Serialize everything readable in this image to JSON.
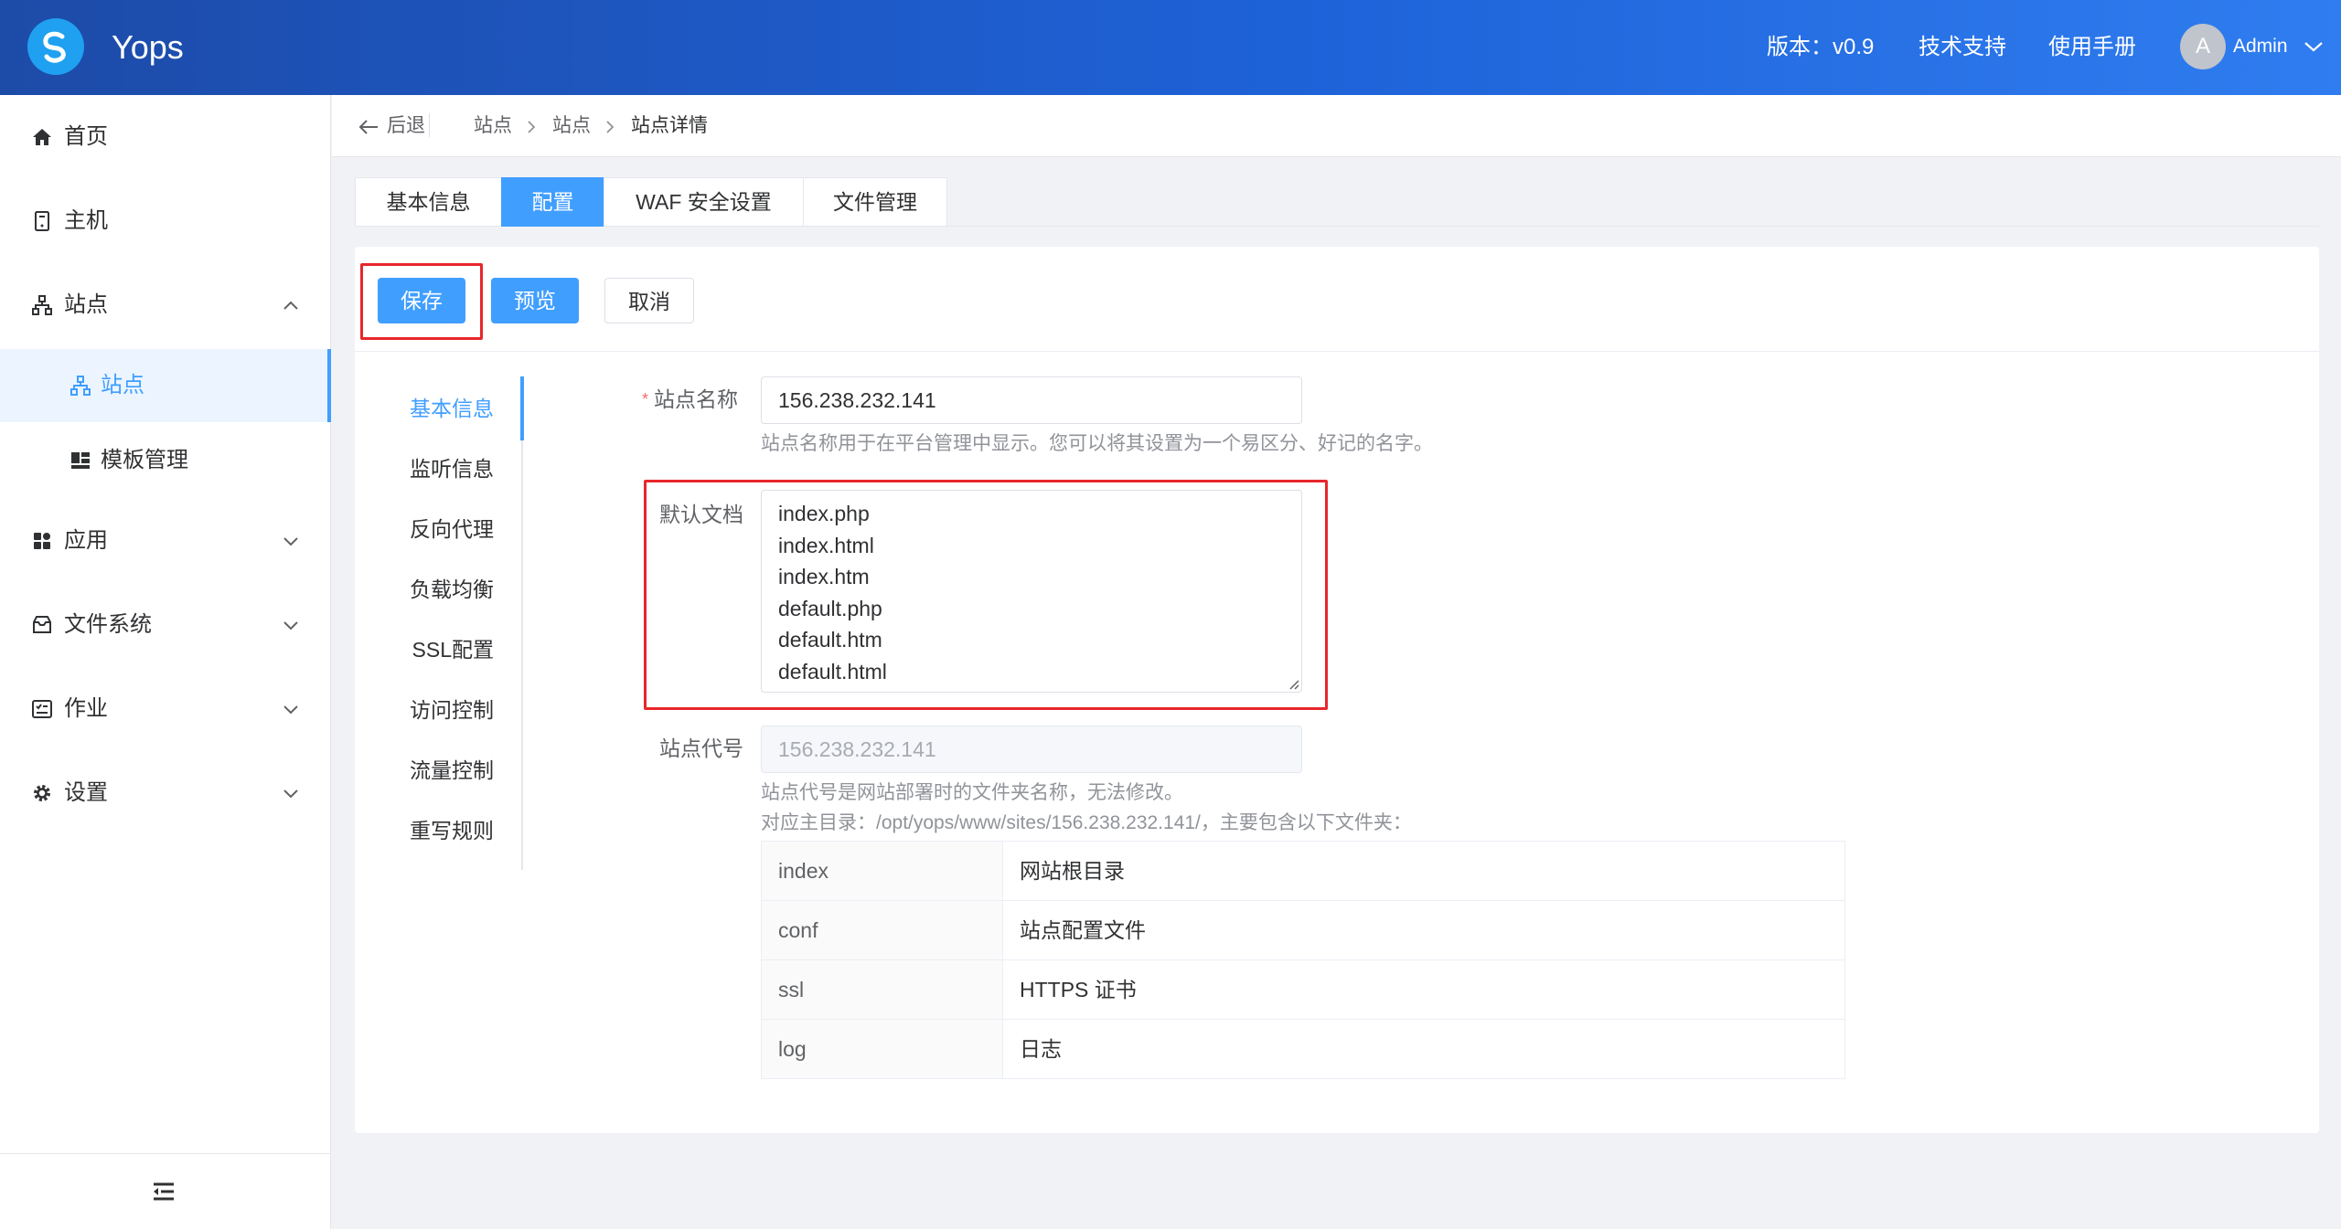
{
  "header": {
    "app_name": "Yops",
    "version": "版本：v0.9",
    "support": "技术支持",
    "manual": "使用手册",
    "avatar_letter": "A",
    "user": "Admin"
  },
  "sidebar": {
    "items": [
      {
        "label": "首页",
        "icon": "home-icon"
      },
      {
        "label": "主机",
        "icon": "server-icon"
      },
      {
        "label": "站点",
        "icon": "sitemap-icon"
      },
      {
        "label": "站点",
        "icon": "sitemap-icon"
      },
      {
        "label": "模板管理",
        "icon": "template-icon"
      },
      {
        "label": "应用",
        "icon": "apps-icon"
      },
      {
        "label": "文件系统",
        "icon": "storage-icon"
      },
      {
        "label": "作业",
        "icon": "job-icon"
      },
      {
        "label": "设置",
        "icon": "gear-icon"
      }
    ]
  },
  "breadcrumb": {
    "back": "后退",
    "items": [
      "站点",
      "站点",
      "站点详情"
    ]
  },
  "tabs": [
    {
      "label": "基本信息"
    },
    {
      "label": "配置"
    },
    {
      "label": "WAF 安全设置"
    },
    {
      "label": "文件管理"
    }
  ],
  "toolbar": {
    "save": "保存",
    "preview": "预览",
    "cancel": "取消"
  },
  "config_nav": [
    "基本信息",
    "监听信息",
    "反向代理",
    "负载均衡",
    "SSL配置",
    "访问控制",
    "流量控制",
    "重写规则"
  ],
  "form": {
    "site_name_label": "站点名称",
    "site_name_value": "156.238.232.141",
    "site_name_hint": "站点名称用于在平台管理中显示。您可以将其设置为一个易区分、好记的名字。",
    "default_doc_label": "默认文档",
    "default_docs": [
      "index.php",
      "index.html",
      "index.htm",
      "default.php",
      "default.htm",
      "default.html"
    ],
    "site_code_label": "站点代号",
    "site_code_value": "156.238.232.141",
    "site_code_hint1": "站点代号是网站部署时的文件夹名称，无法修改。",
    "site_code_hint2": "对应主目录：/opt/yops/www/sites/156.238.232.141/，主要包含以下文件夹：",
    "dirs": [
      {
        "name": "index",
        "desc": "网站根目录"
      },
      {
        "name": "conf",
        "desc": "站点配置文件"
      },
      {
        "name": "ssl",
        "desc": "HTTPS 证书"
      },
      {
        "name": "log",
        "desc": "日志"
      }
    ]
  },
  "colors": {
    "primary": "#409eff",
    "header_start": "#1d4ba8",
    "header_end": "#2f7df0",
    "highlight": "#e8262b"
  }
}
